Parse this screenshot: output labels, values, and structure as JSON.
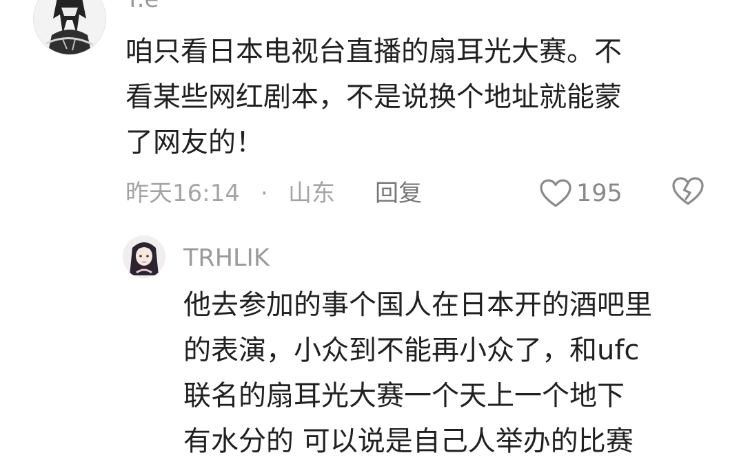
{
  "comment": {
    "username": "T.e",
    "text_lines": [
      "咱只看日本电视台直播的扇耳光大赛。不",
      "看某些网红剧本，不是说换个地址就能蒙",
      "了网友的！"
    ],
    "time": "昨天16:14",
    "separator": "·",
    "location": "山东",
    "reply_label": "回复",
    "like_count": "195",
    "icons": {
      "like": "heart-outline-icon",
      "dislike": "broken-heart-icon"
    }
  },
  "reply": {
    "username": "TRHLIK",
    "text_lines": [
      "他去参加的事个国人在日本开的酒吧里",
      "的表演，小众到不能再小众了，和ufc",
      "联名的扇耳光大赛一个天上一个地下",
      "有水分的 可以说是自己人举办的比赛"
    ]
  },
  "colors": {
    "text": "#202020",
    "meta": "#a4a4a4",
    "icon": "#8a8a8a"
  }
}
